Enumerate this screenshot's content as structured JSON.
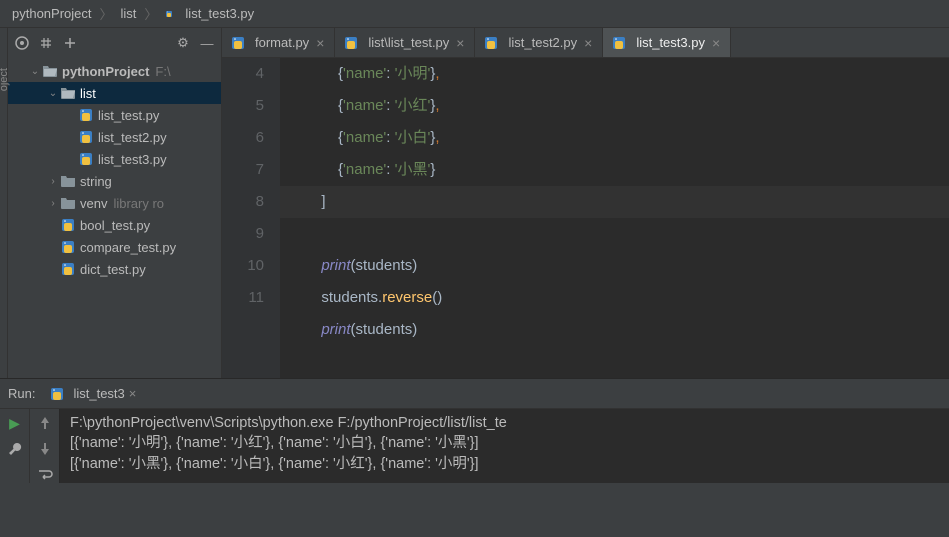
{
  "breadcrumb": {
    "root": "pythonProject",
    "mid": "list",
    "file": "list_test3.py"
  },
  "toolbar": {
    "gear": "⚙",
    "hide": "—"
  },
  "tree": [
    {
      "lvl": 1,
      "kind": "folder-open",
      "label": "pythonProject",
      "meta": "F:\\",
      "arrow": "v",
      "bold": true
    },
    {
      "lvl": 2,
      "kind": "folder-open",
      "label": "list",
      "arrow": "v",
      "selected": true
    },
    {
      "lvl": 3,
      "kind": "py",
      "label": "list_test.py"
    },
    {
      "lvl": 3,
      "kind": "py",
      "label": "list_test2.py"
    },
    {
      "lvl": 3,
      "kind": "py",
      "label": "list_test3.py"
    },
    {
      "lvl": 2,
      "kind": "folder",
      "label": "string",
      "arrow": ">"
    },
    {
      "lvl": 2,
      "kind": "folder-muted",
      "label": "venv",
      "meta": "library ro",
      "arrow": ">"
    },
    {
      "lvl": 2,
      "kind": "py",
      "label": "bool_test.py"
    },
    {
      "lvl": 2,
      "kind": "py",
      "label": "compare_test.py"
    },
    {
      "lvl": 2,
      "kind": "py",
      "label": "dict_test.py"
    }
  ],
  "tabs": [
    {
      "label": "format.py",
      "active": false
    },
    {
      "label": "list\\list_test.py",
      "active": false
    },
    {
      "label": "list_test2.py",
      "active": false
    },
    {
      "label": "list_test3.py",
      "active": true
    }
  ],
  "code": {
    "lines": [
      "4",
      "5",
      "6",
      "7",
      "8",
      "9",
      "10",
      "11"
    ]
  },
  "run": {
    "title": "Run:",
    "tab": "list_test3",
    "cmd": "F:\\pythonProject\\venv\\Scripts\\python.exe F:/pythonProject/list/list_te",
    "out1": "[{'name': '小明'}, {'name': '小红'}, {'name': '小白'}, {'name': '小黑'}]",
    "out2": "[{'name': '小黑'}, {'name': '小白'}, {'name': '小红'}, {'name': '小明'}]"
  }
}
